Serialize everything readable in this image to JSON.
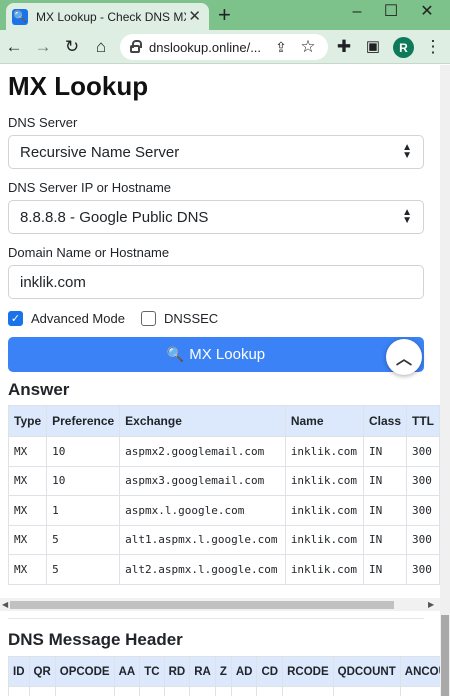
{
  "browser": {
    "tab_title": "MX Lookup - Check DNS MX R",
    "new_tab": "+",
    "url": "dnslookup.online/...",
    "avatar_letter": "R",
    "window_controls": {
      "minimize": "–",
      "maximize": "☐",
      "close": "✕"
    }
  },
  "page": {
    "title": "MX Lookup",
    "dns_server_label": "DNS Server",
    "dns_server_value": "Recursive Name Server",
    "dns_ip_label": "DNS Server IP or Hostname",
    "dns_ip_value": "8.8.8.8 - Google Public DNS",
    "domain_label": "Domain Name or Hostname",
    "domain_value": "inklik.com",
    "advanced_mode_label": "Advanced Mode",
    "advanced_mode_checked": true,
    "dnssec_label": "DNSSEC",
    "dnssec_checked": false,
    "lookup_button": "MX Lookup"
  },
  "answer": {
    "heading": "Answer",
    "columns": [
      "Type",
      "Preference",
      "Exchange",
      "Name",
      "Class",
      "TTL"
    ],
    "rows": [
      [
        "MX",
        "10",
        "aspmx2.googlemail.com",
        "inklik.com",
        "IN",
        "300"
      ],
      [
        "MX",
        "10",
        "aspmx3.googlemail.com",
        "inklik.com",
        "IN",
        "300"
      ],
      [
        "MX",
        "1",
        "aspmx.l.google.com",
        "inklik.com",
        "IN",
        "300"
      ],
      [
        "MX",
        "5",
        "alt1.aspmx.l.google.com",
        "inklik.com",
        "IN",
        "300"
      ],
      [
        "MX",
        "5",
        "alt2.aspmx.l.google.com",
        "inklik.com",
        "IN",
        "300"
      ]
    ]
  },
  "header_section": {
    "heading": "DNS Message Header",
    "columns": [
      "ID",
      "QR",
      "OPCODE",
      "AA",
      "TC",
      "RD",
      "RA",
      "Z",
      "AD",
      "CD",
      "RCODE",
      "QDCOUNT",
      "ANCOUNT"
    ]
  },
  "colors": {
    "accent": "#3b82f6",
    "table_header": "#dce8fb",
    "browser_frame": "#7cc28a"
  }
}
